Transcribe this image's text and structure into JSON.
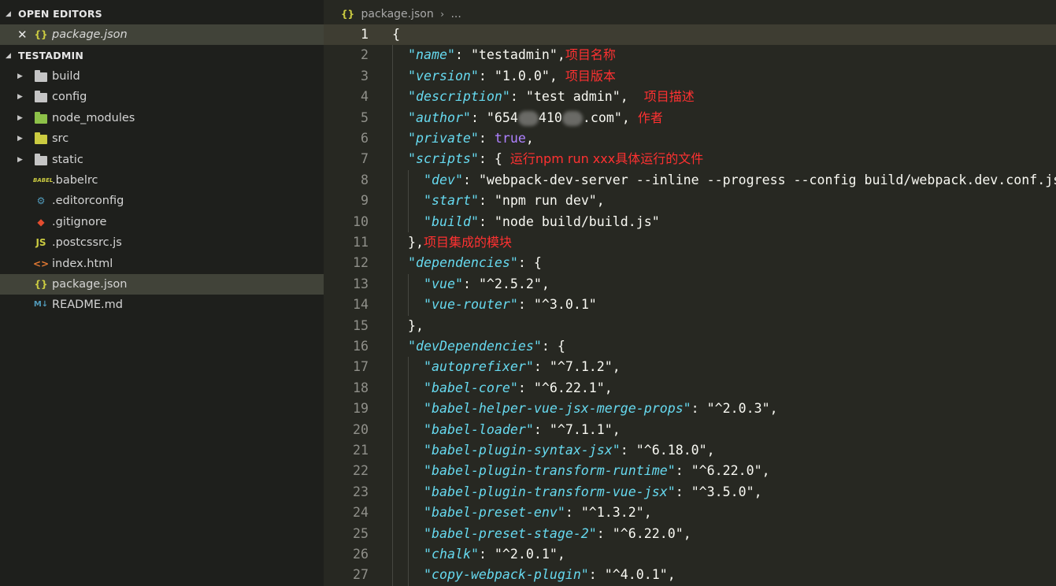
{
  "sidebar": {
    "open_editors": {
      "header": "OPEN EDITORS",
      "items": [
        {
          "close_glyph": "✕",
          "icon": "json-braces-icon",
          "icon_text": "{}",
          "label": "package.json"
        }
      ]
    },
    "project": {
      "header": "TESTADMIN",
      "items": [
        {
          "label": "build",
          "kind": "folder",
          "icon": "folder-icon",
          "color": "#c5c5c5"
        },
        {
          "label": "config",
          "kind": "folder",
          "icon": "folder-icon",
          "color": "#c5c5c5"
        },
        {
          "label": "node_modules",
          "kind": "folder",
          "icon": "node-folder-icon",
          "color": "#8dc149"
        },
        {
          "label": "src",
          "kind": "folder",
          "icon": "src-folder-icon",
          "color": "#cbcb41"
        },
        {
          "label": "static",
          "kind": "folder",
          "icon": "folder-icon",
          "color": "#c5c5c5"
        },
        {
          "label": ".babelrc",
          "kind": "file",
          "icon": "babel-icon",
          "icon_text": "BABEL",
          "color": "#cbcb41"
        },
        {
          "label": ".editorconfig",
          "kind": "file",
          "icon": "editorconfig-icon",
          "icon_text": "⚙",
          "color": "#519aba"
        },
        {
          "label": ".gitignore",
          "kind": "file",
          "icon": "git-icon",
          "icon_text": "◆",
          "color": "#e44d2f"
        },
        {
          "label": ".postcssrc.js",
          "kind": "file",
          "icon": "javascript-icon",
          "icon_text": "JS",
          "color": "#cbcb41"
        },
        {
          "label": "index.html",
          "kind": "file",
          "icon": "html-icon",
          "icon_text": "<>",
          "color": "#e37933"
        },
        {
          "label": "package.json",
          "kind": "file",
          "icon": "json-braces-icon",
          "icon_text": "{}",
          "color": "#cbcb41",
          "selected": true
        },
        {
          "label": "README.md",
          "kind": "file",
          "icon": "markdown-icon",
          "icon_text": "M↓",
          "color": "#519aba"
        }
      ]
    }
  },
  "editor": {
    "breadcrumb": {
      "icon": "json-braces-icon",
      "icon_text": "{}",
      "file": "package.json",
      "separator": "›",
      "more": "..."
    },
    "cursor_line": 1,
    "lines": [
      {
        "n": "1",
        "indent": 0,
        "parts": [
          [
            "p",
            "{"
          ]
        ]
      },
      {
        "n": "2",
        "indent": 1,
        "parts": [
          [
            "k",
            "\"name\""
          ],
          [
            "p",
            ": "
          ],
          [
            "s",
            "\"testadmin\""
          ],
          [
            "p",
            ","
          ],
          [
            "a",
            "项目名称"
          ]
        ]
      },
      {
        "n": "3",
        "indent": 1,
        "parts": [
          [
            "k",
            "\"version\""
          ],
          [
            "p",
            ": "
          ],
          [
            "s",
            "\"1.0.0\""
          ],
          [
            "p",
            ", "
          ],
          [
            "a",
            "项目版本"
          ]
        ]
      },
      {
        "n": "4",
        "indent": 1,
        "parts": [
          [
            "k",
            "\"description\""
          ],
          [
            "p",
            ": "
          ],
          [
            "s",
            "\"test admin\""
          ],
          [
            "p",
            ",  "
          ],
          [
            "a",
            "项目描述"
          ]
        ]
      },
      {
        "n": "5",
        "indent": 1,
        "parts": [
          [
            "k",
            "\"author\""
          ],
          [
            "p",
            ": "
          ],
          [
            "s",
            "\"654"
          ],
          [
            "blur",
            ""
          ],
          [
            "s",
            "410"
          ],
          [
            "blur",
            ""
          ],
          [
            "s",
            ".com\""
          ],
          [
            "p",
            ", "
          ],
          [
            "a",
            "作者"
          ]
        ]
      },
      {
        "n": "6",
        "indent": 1,
        "parts": [
          [
            "k",
            "\"private\""
          ],
          [
            "p",
            ": "
          ],
          [
            "b",
            "true"
          ],
          [
            "p",
            ","
          ]
        ]
      },
      {
        "n": "7",
        "indent": 1,
        "parts": [
          [
            "k",
            "\"scripts\""
          ],
          [
            "p",
            ": { "
          ],
          [
            "a",
            "运行npm run xxx具体运行的文件"
          ]
        ]
      },
      {
        "n": "8",
        "indent": 2,
        "parts": [
          [
            "k",
            "\"dev\""
          ],
          [
            "p",
            ": "
          ],
          [
            "s",
            "\"webpack-dev-server --inline --progress --config build/webpack.dev.conf.js\""
          ],
          [
            "p",
            ","
          ]
        ]
      },
      {
        "n": "9",
        "indent": 2,
        "parts": [
          [
            "k",
            "\"start\""
          ],
          [
            "p",
            ": "
          ],
          [
            "s",
            "\"npm run dev\""
          ],
          [
            "p",
            ","
          ]
        ]
      },
      {
        "n": "10",
        "indent": 2,
        "parts": [
          [
            "k",
            "\"build\""
          ],
          [
            "p",
            ": "
          ],
          [
            "s",
            "\"node build/build.js\""
          ]
        ]
      },
      {
        "n": "11",
        "indent": 1,
        "parts": [
          [
            "p",
            "},"
          ],
          [
            "a",
            "项目集成的模块"
          ]
        ]
      },
      {
        "n": "12",
        "indent": 1,
        "parts": [
          [
            "k",
            "\"dependencies\""
          ],
          [
            "p",
            ": {"
          ]
        ]
      },
      {
        "n": "13",
        "indent": 2,
        "parts": [
          [
            "k",
            "\"vue\""
          ],
          [
            "p",
            ": "
          ],
          [
            "s",
            "\"^2.5.2\""
          ],
          [
            "p",
            ","
          ]
        ]
      },
      {
        "n": "14",
        "indent": 2,
        "parts": [
          [
            "k",
            "\"vue-router\""
          ],
          [
            "p",
            ": "
          ],
          [
            "s",
            "\"^3.0.1\""
          ]
        ]
      },
      {
        "n": "15",
        "indent": 1,
        "parts": [
          [
            "p",
            "},"
          ]
        ]
      },
      {
        "n": "16",
        "indent": 1,
        "parts": [
          [
            "k",
            "\"devDependencies\""
          ],
          [
            "p",
            ": {"
          ]
        ]
      },
      {
        "n": "17",
        "indent": 2,
        "parts": [
          [
            "k",
            "\"autoprefixer\""
          ],
          [
            "p",
            ": "
          ],
          [
            "s",
            "\"^7.1.2\""
          ],
          [
            "p",
            ","
          ]
        ]
      },
      {
        "n": "18",
        "indent": 2,
        "parts": [
          [
            "k",
            "\"babel-core\""
          ],
          [
            "p",
            ": "
          ],
          [
            "s",
            "\"^6.22.1\""
          ],
          [
            "p",
            ","
          ]
        ]
      },
      {
        "n": "19",
        "indent": 2,
        "parts": [
          [
            "k",
            "\"babel-helper-vue-jsx-merge-props\""
          ],
          [
            "p",
            ": "
          ],
          [
            "s",
            "\"^2.0.3\""
          ],
          [
            "p",
            ","
          ]
        ]
      },
      {
        "n": "20",
        "indent": 2,
        "parts": [
          [
            "k",
            "\"babel-loader\""
          ],
          [
            "p",
            ": "
          ],
          [
            "s",
            "\"^7.1.1\""
          ],
          [
            "p",
            ","
          ]
        ]
      },
      {
        "n": "21",
        "indent": 2,
        "parts": [
          [
            "k",
            "\"babel-plugin-syntax-jsx\""
          ],
          [
            "p",
            ": "
          ],
          [
            "s",
            "\"^6.18.0\""
          ],
          [
            "p",
            ","
          ]
        ]
      },
      {
        "n": "22",
        "indent": 2,
        "parts": [
          [
            "k",
            "\"babel-plugin-transform-runtime\""
          ],
          [
            "p",
            ": "
          ],
          [
            "s",
            "\"^6.22.0\""
          ],
          [
            "p",
            ","
          ]
        ]
      },
      {
        "n": "23",
        "indent": 2,
        "parts": [
          [
            "k",
            "\"babel-plugin-transform-vue-jsx\""
          ],
          [
            "p",
            ": "
          ],
          [
            "s",
            "\"^3.5.0\""
          ],
          [
            "p",
            ","
          ]
        ]
      },
      {
        "n": "24",
        "indent": 2,
        "parts": [
          [
            "k",
            "\"babel-preset-env\""
          ],
          [
            "p",
            ": "
          ],
          [
            "s",
            "\"^1.3.2\""
          ],
          [
            "p",
            ","
          ]
        ]
      },
      {
        "n": "25",
        "indent": 2,
        "parts": [
          [
            "k",
            "\"babel-preset-stage-2\""
          ],
          [
            "p",
            ": "
          ],
          [
            "s",
            "\"^6.22.0\""
          ],
          [
            "p",
            ","
          ]
        ]
      },
      {
        "n": "26",
        "indent": 2,
        "parts": [
          [
            "k",
            "\"chalk\""
          ],
          [
            "p",
            ": "
          ],
          [
            "s",
            "\"^2.0.1\""
          ],
          [
            "p",
            ","
          ]
        ]
      },
      {
        "n": "27",
        "indent": 2,
        "parts": [
          [
            "k",
            "\"copy-webpack-plugin\""
          ],
          [
            "p",
            ": "
          ],
          [
            "s",
            "\"^4.0.1\""
          ],
          [
            "p",
            ","
          ]
        ]
      }
    ]
  }
}
